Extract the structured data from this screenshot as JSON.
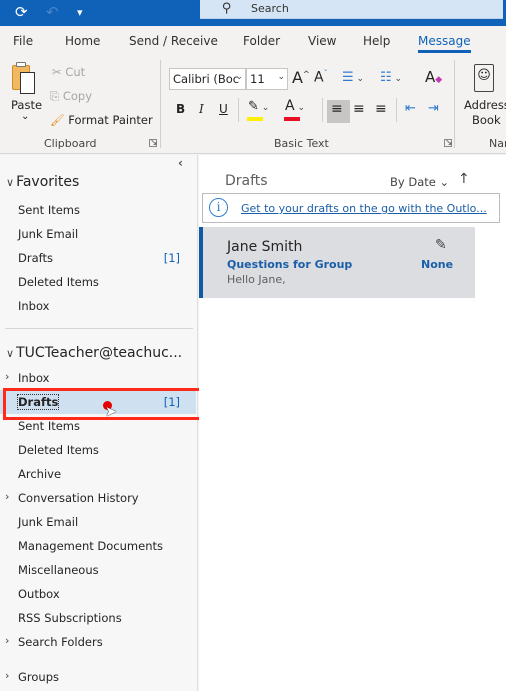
{
  "titlebar": {
    "search_placeholder": "Search",
    "icons": [
      "sync-icon",
      "undo-icon",
      "customize-quick-access-icon",
      "search-icon"
    ]
  },
  "tabs": [
    {
      "label": "File",
      "active": false
    },
    {
      "label": "Home",
      "active": false
    },
    {
      "label": "Send / Receive",
      "active": false
    },
    {
      "label": "Folder",
      "active": false
    },
    {
      "label": "View",
      "active": false
    },
    {
      "label": "Help",
      "active": false
    },
    {
      "label": "Message",
      "active": true
    }
  ],
  "ribbon": {
    "clipboard": {
      "label": "Clipboard",
      "paste": "Paste",
      "paste_arrow": "⌄",
      "cut": "Cut",
      "copy": "Copy",
      "format_painter": "Format Painter"
    },
    "basic_text": {
      "label": "Basic Text",
      "font_name": "Calibri (Boc",
      "font_size": "11",
      "grow_font": "A",
      "shrink_font": "A",
      "bold": "B",
      "italic": "I",
      "underline": "U",
      "highlight_color": "#ffef00",
      "font_color": "#e81123"
    },
    "names": {
      "label": "Nar",
      "address_book_line1": "Address",
      "address_book_line2": "Book"
    }
  },
  "nav": {
    "favorites_header": "Favorites",
    "favorites": [
      {
        "label": "Sent Items",
        "count": ""
      },
      {
        "label": "Junk Email",
        "count": ""
      },
      {
        "label": "Drafts",
        "count": "[1]"
      },
      {
        "label": "Deleted Items",
        "count": ""
      },
      {
        "label": "Inbox",
        "count": ""
      }
    ],
    "account_header": "TUCTeacher@teachuc...",
    "folders": [
      {
        "label": "Inbox",
        "count": "",
        "expandable": true,
        "selected": false
      },
      {
        "label": "Drafts",
        "count": "[1]",
        "expandable": false,
        "selected": true
      },
      {
        "label": "Sent Items",
        "count": "",
        "expandable": false,
        "selected": false
      },
      {
        "label": "Deleted Items",
        "count": "",
        "expandable": false,
        "selected": false
      },
      {
        "label": "Archive",
        "count": "",
        "expandable": false,
        "selected": false
      },
      {
        "label": "Conversation History",
        "count": "",
        "expandable": true,
        "selected": false
      },
      {
        "label": "Junk Email",
        "count": "",
        "expandable": false,
        "selected": false
      },
      {
        "label": "Management Documents",
        "count": "",
        "expandable": false,
        "selected": false
      },
      {
        "label": "Miscellaneous",
        "count": "",
        "expandable": false,
        "selected": false
      },
      {
        "label": "Outbox",
        "count": "",
        "expandable": false,
        "selected": false
      },
      {
        "label": "RSS Subscriptions",
        "count": "",
        "expandable": false,
        "selected": false
      },
      {
        "label": "Search Folders",
        "count": "",
        "expandable": true,
        "selected": false
      }
    ],
    "groups_header": "Groups"
  },
  "message_list": {
    "title": "Drafts",
    "sort_label": "By Date",
    "sort_direction": "↑",
    "info_text": "Get to your drafts on the go with the Outlo...",
    "messages": [
      {
        "from": "Jane Smith",
        "subject": "Questions for Group",
        "preview": "Hello Jane,",
        "category": "None"
      }
    ]
  },
  "colors": {
    "accent": "#0f62b8",
    "highlight_box": "#ff2a1a",
    "selected_folder": "#cfe0f1"
  }
}
